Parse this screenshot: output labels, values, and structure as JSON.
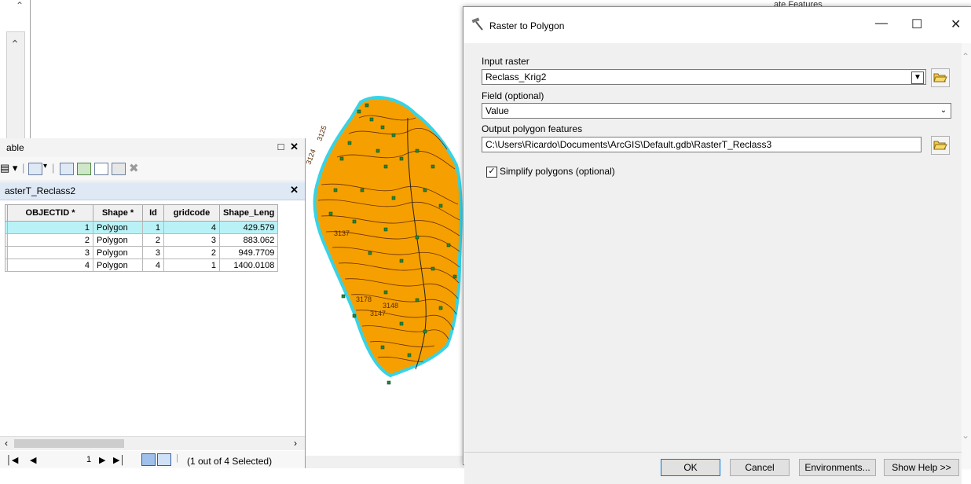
{
  "background_hint": "ate Features",
  "table_window": {
    "title": "able",
    "tab_label": "asterT_Reclass2",
    "columns": [
      "OBJECTID *",
      "Shape *",
      "Id",
      "gridcode",
      "Shape_Leng"
    ],
    "rows": [
      {
        "objectid": "1",
        "shape": "Polygon",
        "id": "1",
        "gridcode": "4",
        "shape_leng": "429.579"
      },
      {
        "objectid": "2",
        "shape": "Polygon",
        "id": "2",
        "gridcode": "3",
        "shape_leng": "883.062"
      },
      {
        "objectid": "3",
        "shape": "Polygon",
        "id": "3",
        "gridcode": "2",
        "shape_leng": "949.7709"
      },
      {
        "objectid": "4",
        "shape": "Polygon",
        "id": "4",
        "gridcode": "1",
        "shape_leng": "1400.0108"
      }
    ],
    "selected_row": 1,
    "record_current": "1",
    "status_text": "(1 out of 4 Selected)"
  },
  "map": {
    "contour_labels": [
      "3124",
      "3125",
      "3137",
      "3147",
      "3148",
      "3178"
    ]
  },
  "dialog": {
    "title": "Raster to Polygon",
    "input_raster_label": "Input raster",
    "input_raster_value": "Reclass_Krig2",
    "field_label": "Field (optional)",
    "field_value": "Value",
    "output_label": "Output polygon features",
    "output_value": "C:\\Users\\Ricardo\\Documents\\ArcGIS\\Default.gdb\\RasterT_Reclass3",
    "simplify_label": "Simplify polygons (optional)",
    "simplify_checked": true,
    "buttons": {
      "ok": "OK",
      "cancel": "Cancel",
      "environments": "Environments...",
      "show_help": "Show Help >>"
    }
  },
  "colors": {
    "polygon_fill": "#f5a000",
    "polygon_outline": "#37d3e6",
    "point": "#1f8a3a",
    "selected_row": "#b9f2f6"
  }
}
